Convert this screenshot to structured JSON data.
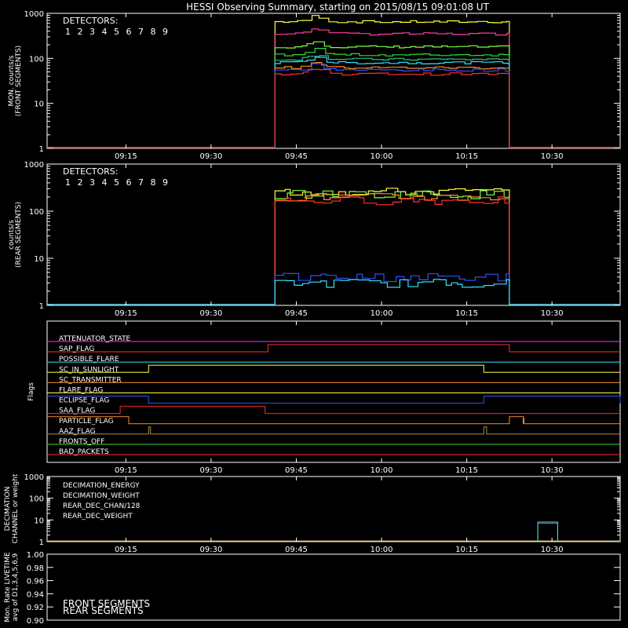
{
  "title": "HESSI Observing Summary, starting on 2015/08/15 09:01:08 UT",
  "time_axis": {
    "start": "09:01:08",
    "end": "10:42:00",
    "ticks": [
      "09:15",
      "09:30",
      "09:45",
      "10:00",
      "10:15",
      "10:30"
    ]
  },
  "detector_legend": {
    "heading": "DETECTORS:",
    "numbers": [
      "1",
      "2",
      "3",
      "4",
      "5",
      "6",
      "7",
      "8",
      "9"
    ],
    "colors": [
      "#ff3030",
      "#ff3fa0",
      "#ff8c2a",
      "#ffff40",
      "#80ff40",
      "#30e030",
      "#30c080",
      "#30e0ff",
      "#3050ff"
    ]
  },
  "chart_data": [
    {
      "id": "front",
      "type": "line",
      "ylabel_line1": "MON. counts/s",
      "ylabel_line2": "(FRONT SEGMENTS)",
      "yscale": "log",
      "ylim": [
        1,
        1000
      ],
      "yticks": [
        "1",
        "10",
        "100",
        "1000"
      ],
      "x_on": "09:41:15",
      "x_off": "10:22:30",
      "series": [
        {
          "color": "#ffff40",
          "level": 650
        },
        {
          "color": "#ff3fa0",
          "level": 350
        },
        {
          "color": "#80ff40",
          "level": 180
        },
        {
          "color": "#30e030",
          "level": 120
        },
        {
          "color": "#30c080",
          "level": 95
        },
        {
          "color": "#30e0ff",
          "level": 80
        },
        {
          "color": "#ff8c2a",
          "level": 62
        },
        {
          "color": "#3050ff",
          "level": 55
        },
        {
          "color": "#ff3030",
          "level": 45
        }
      ]
    },
    {
      "id": "rear",
      "type": "line",
      "ylabel_line1": "counts/s",
      "ylabel_line2": "(REAR SEGMENTS)",
      "yscale": "log",
      "ylim": [
        1,
        1000
      ],
      "yticks": [
        "1",
        "10",
        "100",
        "1000"
      ],
      "x_on": "09:41:15",
      "x_off": "10:22:30",
      "series": [
        {
          "color": "#ffff40",
          "level": 260
        },
        {
          "color": "#80ff40",
          "level": 230
        },
        {
          "color": "#ff8c2a",
          "level": 200
        },
        {
          "color": "#ff3030",
          "level": 170
        },
        {
          "color": "#3050ff",
          "level": 4
        },
        {
          "color": "#30e0ff",
          "level": 3
        }
      ]
    },
    {
      "id": "flags",
      "type": "line",
      "ylabel": "Flags",
      "flags": [
        {
          "name": "ATTENUATOR_STATE",
          "color": "#ff30ff",
          "steps": []
        },
        {
          "name": "SAP_FLAG",
          "color": "#ff3030",
          "steps": [
            [
              "09:40:00",
              "10:22:30"
            ]
          ]
        },
        {
          "name": "POSSIBLE_FLARE",
          "color": "#30e0ff",
          "steps": []
        },
        {
          "name": "SC_IN_SUNLIGHT",
          "color": "#ffff40",
          "steps": [
            [
              "09:19:00",
              "10:18:00"
            ]
          ]
        },
        {
          "name": "SC_TRANSMITTER",
          "color": "#ff8c2a",
          "steps": []
        },
        {
          "name": "FLARE_FLAG",
          "color": "#ffff40",
          "steps": []
        },
        {
          "name": "ECLIPSE_FLAG",
          "color": "#3050ff",
          "steps": [
            [
              "09:01:08",
              "09:19:00"
            ],
            [
              "10:18:00",
              "10:42:00"
            ]
          ]
        },
        {
          "name": "SAA_FLAG",
          "color": "#ff3030",
          "steps": [
            [
              "09:14:00",
              "09:39:30"
            ]
          ]
        },
        {
          "name": "PARTICLE_FLAG",
          "color": "#ff8c2a",
          "steps": [
            [
              "09:01:08",
              "09:15:30"
            ],
            [
              "10:22:30",
              "10:25:00"
            ]
          ],
          "spikes": [
            "10:25:00"
          ]
        },
        {
          "name": "AAZ_FLAG",
          "color": "#b09040",
          "steps": [
            [
              "09:19:00",
              "09:19:20"
            ],
            [
              "10:18:00",
              "10:18:30"
            ]
          ]
        },
        {
          "name": "FRONTS_OFF",
          "color": "#30e030",
          "steps": []
        },
        {
          "name": "BAD_PACKETS",
          "color": "#ff3030",
          "steps": []
        }
      ]
    },
    {
      "id": "decimation",
      "type": "line",
      "ylabel_line1": "DECIMATION",
      "ylabel_line2": "CHANNEL or weight",
      "yscale": "log",
      "ylim": [
        1,
        1000
      ],
      "yticks": [
        "1",
        "10",
        "100",
        "1000"
      ],
      "series": [
        {
          "name": "DECIMATION_ENERGY",
          "color": "#30ff30",
          "pulses": []
        },
        {
          "name": "DECIMATION_WEIGHT",
          "color": "#ff6040",
          "pulses": [
            {
              "from": "10:27:30",
              "to": "10:31:00",
              "value": 7
            }
          ]
        },
        {
          "name": "REAR_DEC_CHAN/128",
          "color": "#30e0ff",
          "pulses": [
            {
              "from": "10:27:30",
              "to": "10:31:00",
              "value": 8
            }
          ]
        },
        {
          "name": "REAR_DEC_WEIGHT",
          "color": "#b0a040",
          "pulses": []
        }
      ]
    },
    {
      "id": "livetime",
      "type": "line",
      "ylabel_line1": "Mon. Rate LIVETIME",
      "ylabel_line2": "avg of D1,3,4,5,6,9",
      "ylim": [
        0.9,
        1.0
      ],
      "yticks": [
        "0.90",
        "0.92",
        "0.94",
        "0.96",
        "0.98",
        "1.00"
      ],
      "series": [
        {
          "name": "FRONT SEGMENTS",
          "color": "#30ff30"
        },
        {
          "name": "REAR SEGMENTS",
          "color": "#208020"
        }
      ]
    }
  ]
}
